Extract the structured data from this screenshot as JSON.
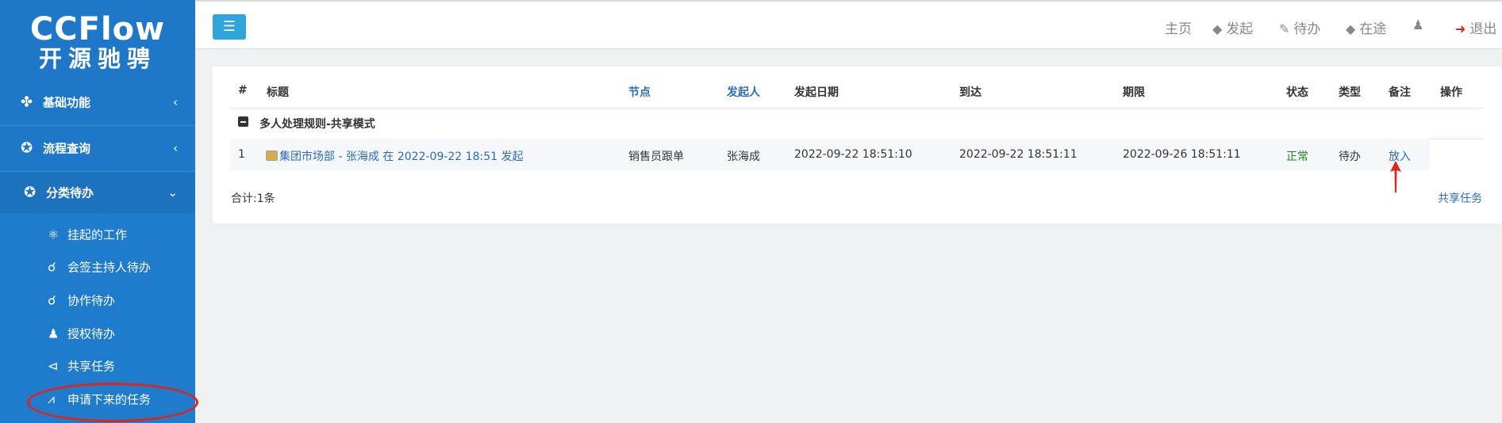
{
  "sidebar": {
    "logo_line1": "CCFlow",
    "logo_line2": "开源驰骋",
    "menu": [
      {
        "icon": "cubes-icon",
        "glyph": "✤",
        "label": "基础功能",
        "arrow": "‹"
      },
      {
        "icon": "globe-icon",
        "glyph": "✪",
        "label": "流程查询",
        "arrow": "‹"
      },
      {
        "icon": "globe-icon",
        "glyph": "✪",
        "label": "分类待办",
        "arrow": "⌄"
      }
    ],
    "submenu": [
      {
        "icon": "atom-icon",
        "glyph": "⚛",
        "label": "挂起的工作"
      },
      {
        "icon": "handshake-icon",
        "glyph": "☌",
        "label": "会签主持人待办"
      },
      {
        "icon": "handshake-icon",
        "glyph": "☌",
        "label": "协作待办"
      },
      {
        "icon": "user-icon",
        "glyph": "♟",
        "label": "授权待办"
      },
      {
        "icon": "share-icon",
        "glyph": "⊲",
        "label": "共享任务"
      },
      {
        "icon": "line-chart-icon",
        "glyph": "⩘",
        "label": "申请下来的任务"
      }
    ]
  },
  "topbar": {
    "toggle_glyph": "☰",
    "nav": [
      {
        "icon": "",
        "glyph": "",
        "label": "主页"
      },
      {
        "icon": "tag-icon",
        "glyph": "◆",
        "label": "发起"
      },
      {
        "icon": "edit-icon",
        "glyph": "✎",
        "label": "待办"
      },
      {
        "icon": "tag-icon",
        "glyph": "◆",
        "label": "在途"
      },
      {
        "icon": "user-icon",
        "glyph": "♟",
        "label": ""
      },
      {
        "icon": "logout-icon",
        "glyph": "➜",
        "label": "退出"
      }
    ]
  },
  "table": {
    "headers": [
      "#",
      "标题",
      "节点",
      "发起人",
      "发起日期",
      "到达",
      "期限",
      "状态",
      "类型",
      "备注",
      "操作"
    ],
    "group_label": "多人处理规则-共享模式",
    "rows": [
      {
        "num": "1",
        "title": "集团市场部 - 张海成 在 2022-09-22 18:51 发起",
        "node": "销售员跟单",
        "starter": "张海成",
        "start_date": "2022-09-22 18:51:10",
        "arrive": "2022-09-22 18:51:11",
        "deadline": "2022-09-26 18:51:11",
        "status": "正常",
        "type": "待办",
        "action": "放入"
      }
    ],
    "total": "合计:1条",
    "share_link": "共享任务"
  },
  "colors": {
    "sidebar": "#1e78c7",
    "accent": "#2fa6db",
    "link": "#2a6dbb",
    "status_ok": "#1a8a1a",
    "annotation": "#e0241b"
  }
}
